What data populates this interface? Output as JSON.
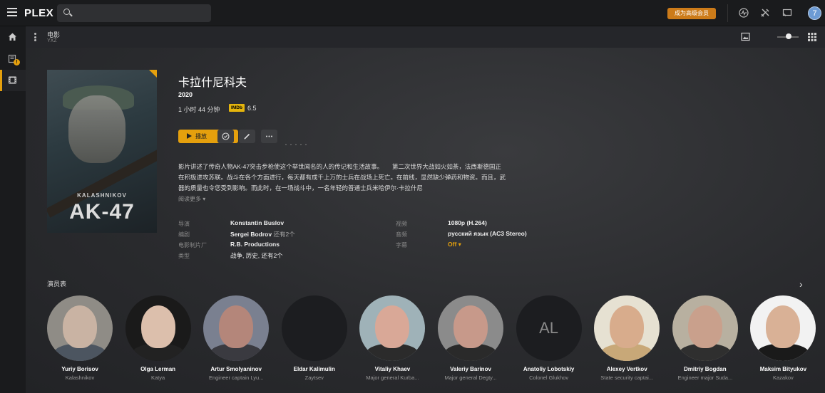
{
  "app": {
    "logo_text": "PLEX"
  },
  "topbar": {
    "search_placeholder": "",
    "premium_button": "成为高级会员",
    "avatar_initial": "7",
    "icons": [
      "activity-icon",
      "tools-icon",
      "cast-icon"
    ]
  },
  "sidebar": {
    "items": [
      {
        "icon": "home-icon"
      },
      {
        "icon": "downloads-icon",
        "badge": "!"
      },
      {
        "icon": "film-icon",
        "active": true
      }
    ]
  },
  "subheader": {
    "title": "电影",
    "subtitle": "YXZ"
  },
  "movie": {
    "title": "卡拉什尼科夫",
    "year": "2020",
    "duration": "1 小时 44 分钟",
    "imdb_label": "IMDb",
    "rating": "6.5",
    "play_label": "播放",
    "summary": "影片讲述了传奇人物AK-47突击步枪使这个举世闻名的人的传记和生活故事。　　第二次世界大战如火如荼，法西斯德国正在积极进攻苏联。战斗在各个方面进行，每天都有成千上万的士兵在战场上死亡。在前线，显然缺少弹药和物资。而且，武器的质量也令您受到影响。而此时，在一场战斗中，一名年轻的普通士兵米哈伊尔·卡拉什尼",
    "read_more": "阅读更多",
    "poster": {
      "kalashnikov": "KALASHNIKOV",
      "title": "AK-47"
    }
  },
  "metadata": {
    "left": [
      {
        "key": "导演",
        "value": "Konstantin Buslov",
        "extra": ""
      },
      {
        "key": "编剧",
        "value": "Sergei Bodrov",
        "extra": " 还有2个"
      },
      {
        "key": "电影制片厂",
        "value": "R.B. Productions",
        "extra": ""
      },
      {
        "key": "类型",
        "value": "战争, 历史, 还有2个",
        "extra": ""
      }
    ],
    "right": [
      {
        "key": "视频",
        "value": "1080p (H.264)"
      },
      {
        "key": "音频",
        "value": "русский язык (AC3 Stereo)"
      },
      {
        "key": "字幕",
        "value": "Off ▾"
      }
    ]
  },
  "cast": {
    "title": "演员表",
    "members": [
      {
        "name": "Yuriy Borisov",
        "role": "Kalashnikov",
        "photo": true,
        "skin": "#c9b3a3",
        "bg": "#8f8c86",
        "cloth": "#4c5560"
      },
      {
        "name": "Olga Lerman",
        "role": "Katya",
        "photo": true,
        "skin": "#dcbfac",
        "bg": "#1a1a1a",
        "cloth": "#222"
      },
      {
        "name": "Artur Smolyaninov",
        "role": "Engineer captain Lyu...",
        "photo": true,
        "skin": "#b4867a",
        "bg": "#7a8090",
        "cloth": "#3a3a40"
      },
      {
        "name": "Eldar Kalimulin",
        "role": "Zaytsev",
        "photo": false,
        "initials": ""
      },
      {
        "name": "Vitaliy Khaev",
        "role": "Major general Kurba...",
        "photo": true,
        "skin": "#d9a897",
        "bg": "#9fb2b8",
        "cloth": "#2b2b2b"
      },
      {
        "name": "Valeriy Barinov",
        "role": "Major general Degty...",
        "photo": true,
        "skin": "#c7998a",
        "bg": "#8b8b8b",
        "cloth": "#2a2a2a"
      },
      {
        "name": "Anatoliy Lobotskiy",
        "role": "Colonel Glukhov",
        "photo": false,
        "initials": "AL"
      },
      {
        "name": "Alexey Vertkov",
        "role": "State security captai...",
        "photo": true,
        "skin": "#d8ac8c",
        "bg": "#e6e1d2",
        "cloth": "#c8a878"
      },
      {
        "name": "Dmitriy Bogdan",
        "role": "Engineer major Suda...",
        "photo": true,
        "skin": "#c9a08c",
        "bg": "#b8b0a0",
        "cloth": "#2f2f2f"
      },
      {
        "name": "Maksim Bityukov",
        "role": "Kazakov",
        "photo": true,
        "skin": "#d9b196",
        "bg": "#f2f2f2",
        "cloth": "#1a1a1a"
      }
    ]
  },
  "colors": {
    "accent": "#e5a00d",
    "premium": "#cc7b19",
    "background": "#1f2023"
  }
}
